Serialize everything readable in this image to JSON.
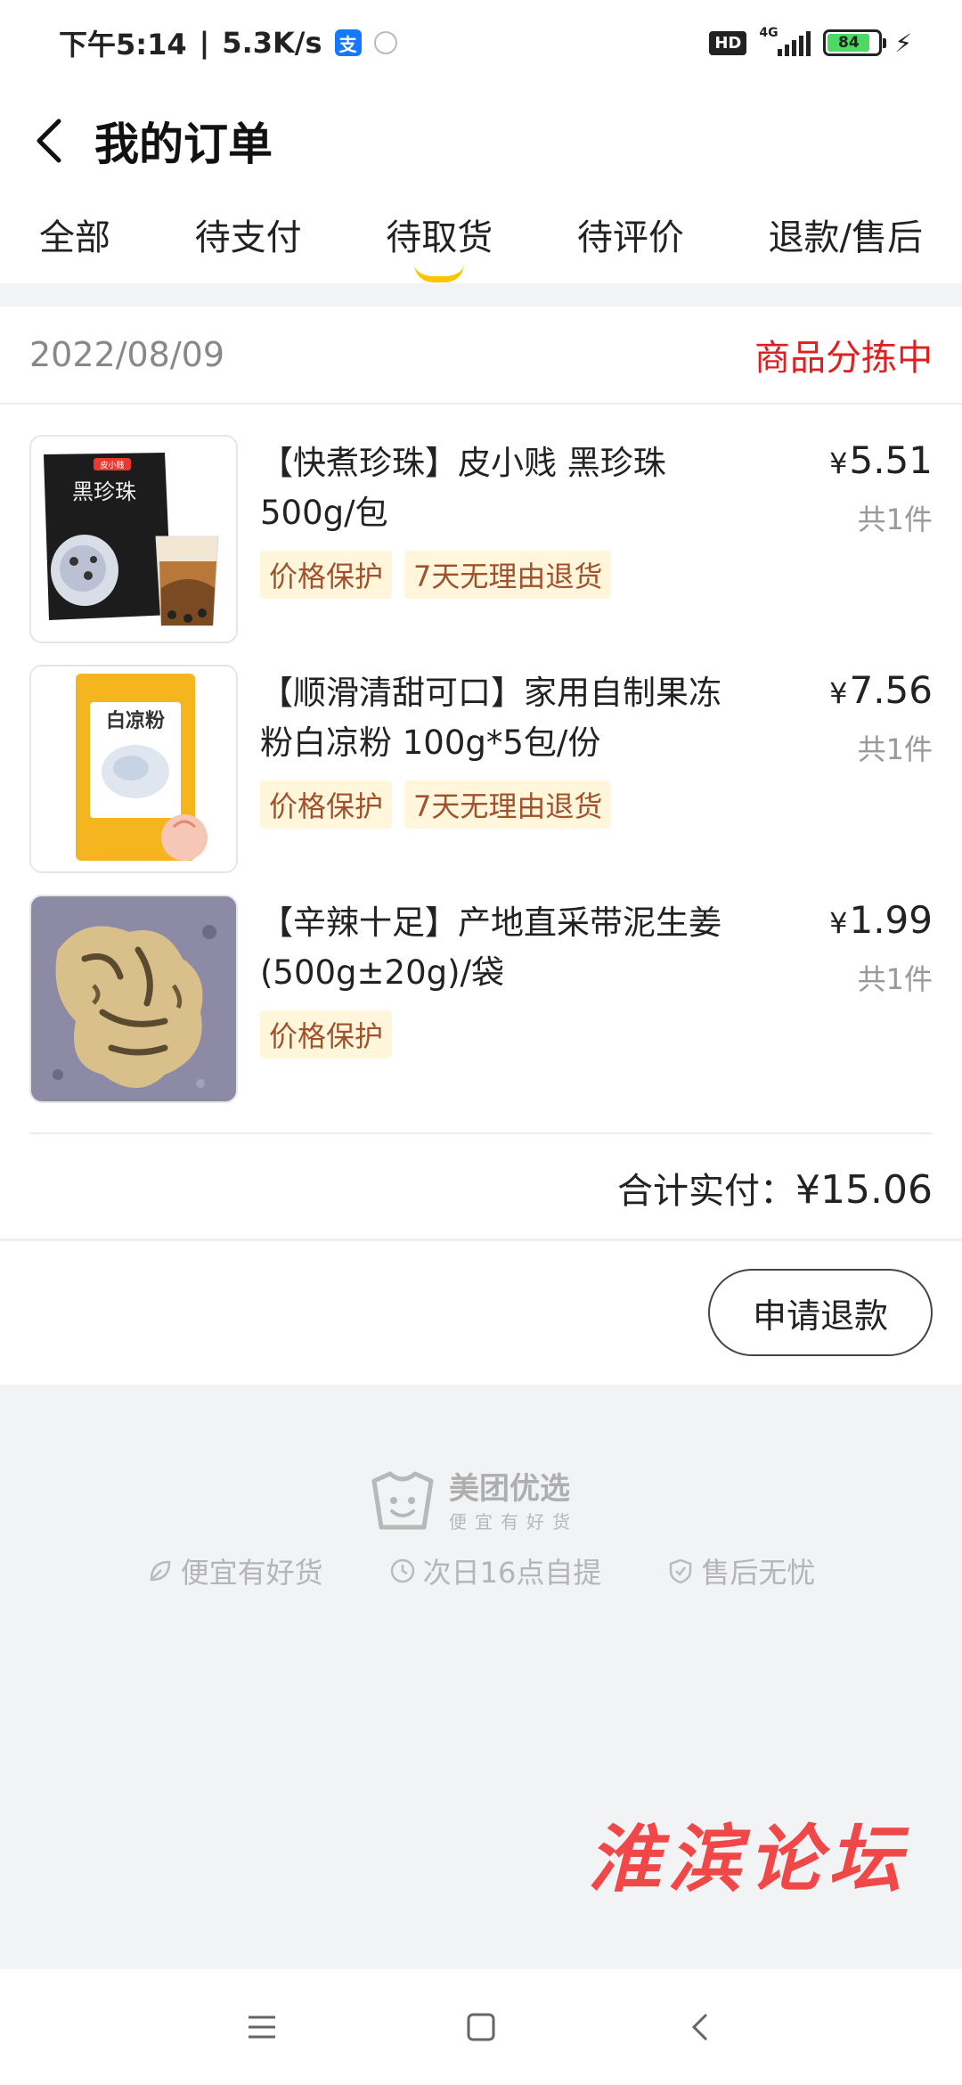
{
  "status_bar": {
    "time": "下午5:14",
    "speed": "5.3K/s",
    "hd": "HD",
    "network": "4G",
    "battery": "84",
    "battery_level": 0.84
  },
  "header": {
    "title": "我的订单"
  },
  "tabs": [
    {
      "label": "全部",
      "active": false
    },
    {
      "label": "待支付",
      "active": false
    },
    {
      "label": "待取货",
      "active": true
    },
    {
      "label": "待评价",
      "active": false
    },
    {
      "label": "退款/售后",
      "active": false
    }
  ],
  "order": {
    "date": "2022/08/09",
    "status": "商品分拣中",
    "items": [
      {
        "title": "【快煮珍珠】皮小贱 黑珍珠500g/包",
        "tags": [
          "价格保护",
          "7天无理由退货"
        ],
        "price": "5.51",
        "qty": "共1件",
        "image_label": "黑珍珠",
        "brand_badge": "皮小贱"
      },
      {
        "title": "【顺滑清甜可口】家用自制果冻粉白凉粉 100g*5包/份",
        "tags": [
          "价格保护",
          "7天无理由退货"
        ],
        "price": "7.56",
        "qty": "共1件",
        "image_label": "白凉粉"
      },
      {
        "title": "【辛辣十足】产地直采带泥生姜 (500g±20g)/袋",
        "tags": [
          "价格保护"
        ],
        "price": "1.99",
        "qty": "共1件"
      }
    ],
    "currency": "¥",
    "total_label": "合计实付：",
    "total": "¥15.06",
    "refund_button": "申请退款"
  },
  "brand": {
    "name": "美团优选",
    "slogan": "便宜有好货",
    "features": [
      {
        "icon": "leaf-icon",
        "label": "便宜有好货"
      },
      {
        "icon": "clock-icon",
        "label": "次日16点自提"
      },
      {
        "icon": "shield-check-icon",
        "label": "售后无忧"
      }
    ]
  },
  "watermark": "淮滨论坛",
  "colors": {
    "accent": "#ffc300",
    "status_red": "#e02020",
    "tag_bg": "#fff6dc",
    "tag_text": "#a0522d"
  }
}
